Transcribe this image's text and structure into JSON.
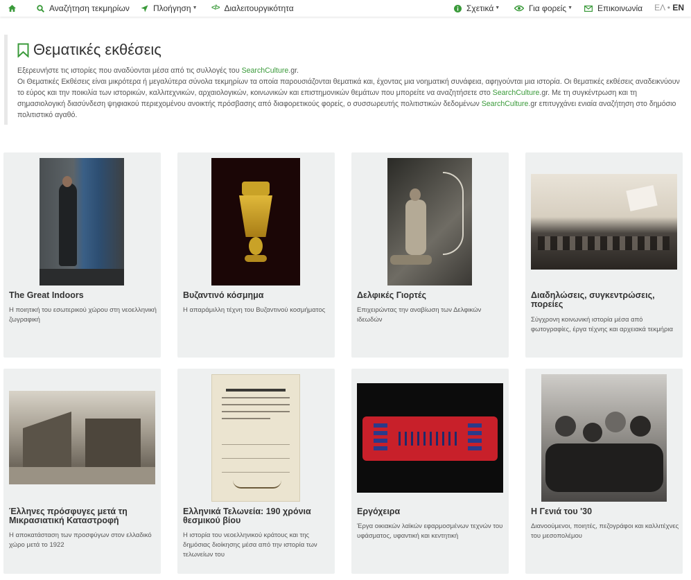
{
  "nav": {
    "search": "Αναζήτηση τεκμηρίων",
    "browse": "Πλοήγηση",
    "interop": "Διαλειτουργικότητα",
    "about": "Σχετικά",
    "providers": "Για φορείς",
    "contact": "Επικοινωνία",
    "lang_el": "ΕΛ",
    "lang_sep": "•",
    "lang_en": "EN"
  },
  "intro": {
    "title": "Θεματικές εκθέσεις",
    "p1a": "Εξερευνήστε τις ιστορίες που αναδύονται μέσα από τις συλλογές του ",
    "p1link": "SearchCulture",
    "p1b": ".gr.",
    "p2a": "Οι Θεματικές Εκθέσεις είναι μικρότερα ή μεγαλύτερα σύνολα τεκμηρίων τα οποία παρουσιάζονται θεματικά και, έχοντας μια νοηματική συνάφεια, αφηγούνται μια ιστορία. Οι θεματικές εκθέσεις αναδεικνύουν το εύρος και την ποικιλία των ιστορικών, καλλιτεχνικών, αρχαιολογικών, κοινωνικών και επιστημονικών θεμάτων που μπορείτε να αναζητήσετε στο ",
    "p2link": "SearchCulture",
    "p2b": ".gr. Με τη συγκέντρωση και τη σημασιολογική διασύνδεση ψηφιακού περιεχομένου ανοικτής πρόσβασης από διαφορετικούς φορείς, ο συσσωρευτής πολιτιστικών δεδομένων ",
    "p2link2": "SearchCulture",
    "p2c": ".gr επιτυγχάνει ενιαία αναζήτηση στο δημόσιο πολιτιστικό αγαθό."
  },
  "cards": [
    {
      "title": "The Great Indoors",
      "desc": "Η ποιητική του εσωτερικού χώρου στη νεοελληνική ζωγραφική"
    },
    {
      "title": "Βυζαντινό κόσμημα",
      "desc": "Η απαράμιλλη τέχνη του Βυζαντινού κοσμήματος"
    },
    {
      "title": "Δελφικές Γιορτές",
      "desc": "Επιχειρώντας την αναβίωση των Δελφικών ιδεωδών"
    },
    {
      "title": "Διαδηλώσεις, συγκεντρώσεις, πορείες",
      "desc": "Σύγχρονη κοινωνική ιστορία μέσα από φωτογραφίες, έργα τέχνης και αρχειακά τεκμήρια"
    },
    {
      "title": "Έλληνες πρόσφυγες μετά τη Μικρασιατική Καταστροφή",
      "desc": "Η αποκατάσταση των προσφύγων στον ελλαδικό χώρο μετά το 1922"
    },
    {
      "title": "Ελληνικά Τελωνεία: 190 χρόνια θεσμικού βίου",
      "desc": "Η ιστορία του νεοελληνικού κράτους και της δημόσιας διοίκησης μέσα από την ιστορία των τελωνείων του"
    },
    {
      "title": "Εργόχειρα",
      "desc": "Έργα οικιακών λαϊκών εφαρμοσμένων τεχνών του υφάσματος, υφαντική και κεντητική"
    },
    {
      "title": "Η Γενιά του '30",
      "desc": "Διανοούμενοι, ποιητές, πεζογράφοι και καλλιτέχνες του μεσοπολέμου"
    }
  ],
  "colors": {
    "accent": "#3a9a3a",
    "card_bg": "#eef0f0"
  },
  "icons": [
    "home-icon",
    "search-icon",
    "navigation-arrow-icon",
    "code-icon",
    "info-icon",
    "eye-icon",
    "envelope-icon",
    "bookmark-icon"
  ]
}
